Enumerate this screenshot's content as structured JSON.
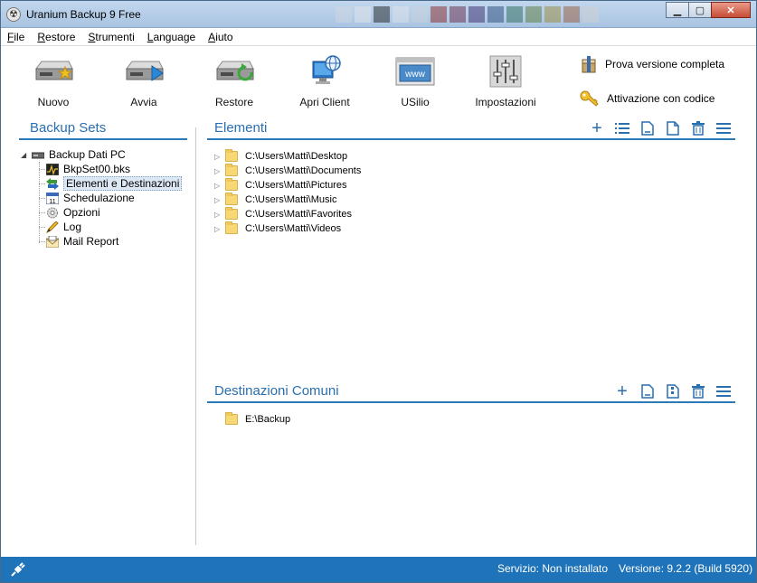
{
  "window": {
    "title": "Uranium Backup 9 Free"
  },
  "menu": [
    {
      "u": "F",
      "rest": "ile"
    },
    {
      "u": "R",
      "rest": "estore"
    },
    {
      "u": "S",
      "rest": "trumenti"
    },
    {
      "u": "L",
      "rest": "anguage"
    },
    {
      "u": "A",
      "rest": "iuto"
    }
  ],
  "toolbar": {
    "nuovo": "Nuovo",
    "avvia": "Avvia",
    "restore": "Restore",
    "apri_client": "Apri Client",
    "usilio": "USilio",
    "impostazioni": "Impostazioni",
    "prova": "Prova versione completa",
    "attivazione": "Attivazione con codice"
  },
  "backup_sets": {
    "title": "Backup Sets",
    "root": "Backup Dati PC",
    "children": [
      "BkpSet00.bks",
      "Elementi e Destinazioni",
      "Schedulazione",
      "Opzioni",
      "Log",
      "Mail Report"
    ]
  },
  "elementi": {
    "title": "Elementi",
    "items": [
      "C:\\Users\\Matti\\Desktop",
      "C:\\Users\\Matti\\Documents",
      "C:\\Users\\Matti\\Pictures",
      "C:\\Users\\Matti\\Music",
      "C:\\Users\\Matti\\Favorites",
      "C:\\Users\\Matti\\Videos"
    ]
  },
  "destinazioni": {
    "title": "Destinazioni Comuni",
    "items": [
      "E:\\Backup"
    ]
  },
  "status": {
    "service": "Servizio: Non installato",
    "version": "Versione: 9.2.2 (Build 5920)"
  }
}
